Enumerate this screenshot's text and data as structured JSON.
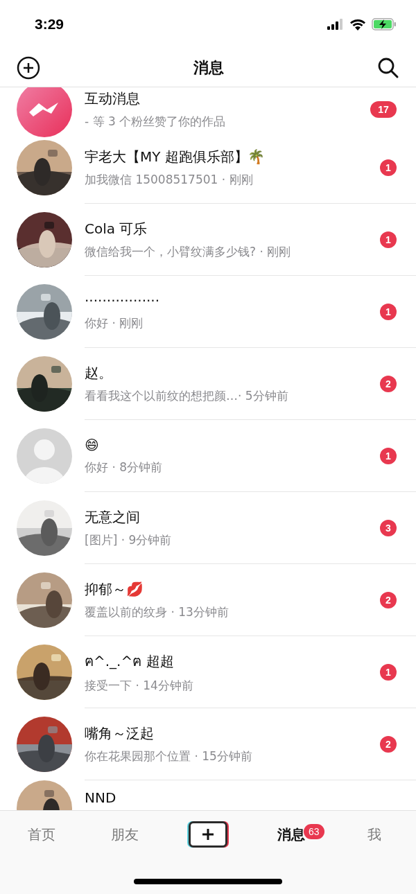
{
  "status_bar": {
    "time": "3:29"
  },
  "header": {
    "title": "消息"
  },
  "conversations": [
    {
      "kind": "interaction",
      "name": "互动消息",
      "preview": "- 等 3 个粉丝赞了你的作品",
      "unread": "17"
    },
    {
      "kind": "contact",
      "name": "宇老大【MY 超跑俱乐部】🌴",
      "preview": "加我微信 15008517501 · 刚刚",
      "unread": "1"
    },
    {
      "kind": "contact",
      "name": "Cola 可乐",
      "preview": "微信给我一个，小臂纹满多少钱? · 刚刚",
      "unread": "1"
    },
    {
      "kind": "contact",
      "name": "·················",
      "preview": "你好 · 刚刚",
      "unread": "1"
    },
    {
      "kind": "contact",
      "name": "赵。",
      "preview": "看看我这个以前纹的想把颜…· 5分钟前",
      "unread": "2"
    },
    {
      "kind": "blank",
      "name": "😄",
      "preview": "你好 · 8分钟前",
      "unread": "1"
    },
    {
      "kind": "contact",
      "name": "无意之间",
      "preview": "[图片] · 9分钟前",
      "unread": "3"
    },
    {
      "kind": "contact",
      "name": "抑郁～💋",
      "preview": "覆盖以前的纹身 · 13分钟前",
      "unread": "2"
    },
    {
      "kind": "contact",
      "name": "ฅ^._.^ฅ 超超",
      "preview": " 接受一下 · 14分钟前",
      "unread": "1"
    },
    {
      "kind": "contact",
      "name": "嘴角～泛起",
      "preview": "你在花果园那个位置 · 15分钟前",
      "unread": "2"
    },
    {
      "kind": "contact",
      "name": "NND"
    }
  ],
  "tab_bar": [
    {
      "kind": "tab",
      "label": "首页",
      "selected": false
    },
    {
      "kind": "tab",
      "label": "朋友",
      "selected": false
    },
    {
      "kind": "create"
    },
    {
      "kind": "tab",
      "label": "消息",
      "selected": true,
      "badge": "63"
    },
    {
      "kind": "tab",
      "label": "我",
      "selected": false
    }
  ]
}
